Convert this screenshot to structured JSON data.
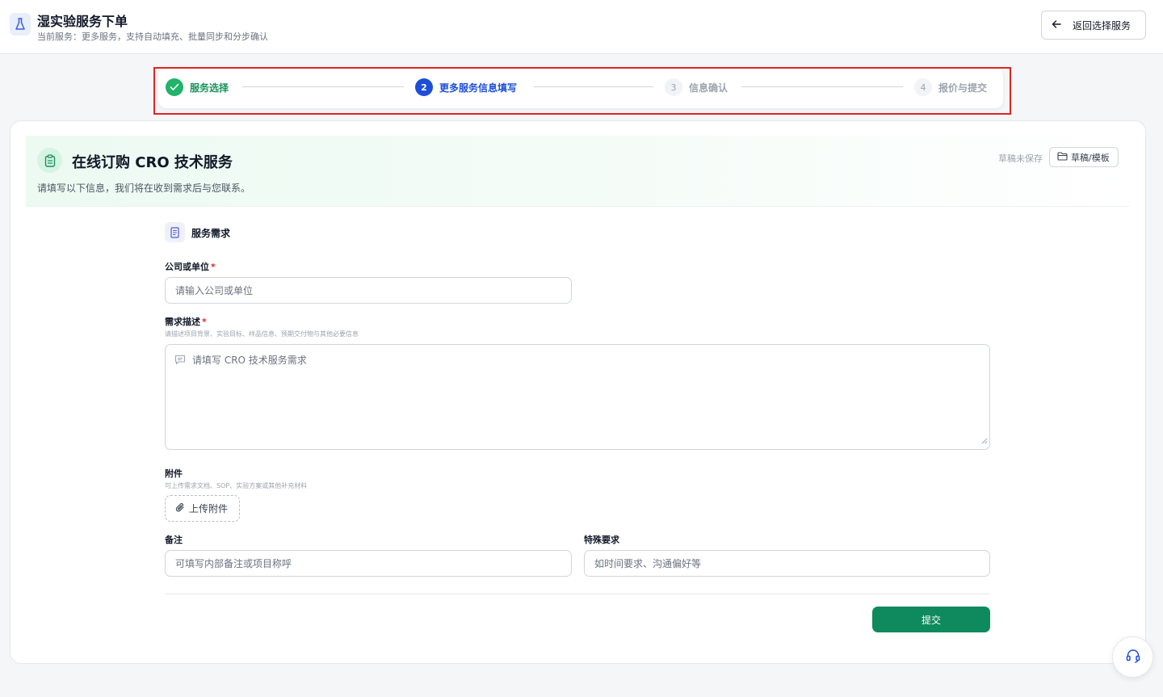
{
  "header": {
    "title": "湿实验服务下单",
    "subtitle": "当前服务：更多服务，支持自动填充、批量同步和分步确认",
    "back_label": "返回选择服务"
  },
  "stepper": {
    "steps": [
      {
        "num": "",
        "label": "服务选择",
        "state": "done"
      },
      {
        "num": "2",
        "label": "更多服务信息填写",
        "state": "active"
      },
      {
        "num": "3",
        "label": "信息确认",
        "state": "pending"
      },
      {
        "num": "4",
        "label": "报价与提交",
        "state": "pending"
      }
    ]
  },
  "hero": {
    "title": "在线订购 CRO 技术服务",
    "description": "请填写以下信息，我们将在收到需求后与您联系。",
    "draft_status": "草稿未保存",
    "draft_button": "草稿/模板"
  },
  "form": {
    "section_title": "服务需求",
    "company": {
      "label": "公司或单位",
      "required_mark": "*",
      "placeholder": "请输入公司或单位"
    },
    "description": {
      "label": "需求描述",
      "required_mark": "*",
      "hint": "请描述项目背景、实验目标、样品信息、预期交付物与其他必要信息",
      "placeholder": "请填写 CRO 技术服务需求"
    },
    "attachment": {
      "label": "附件",
      "hint": "可上传需求文档、SOP、实验方案或其他补充材料",
      "button": "上传附件"
    },
    "notes": {
      "label": "备注",
      "placeholder": "可填写内部备注或项目称呼"
    },
    "special": {
      "label": "特殊要求",
      "placeholder": "如时间要求、沟通偏好等"
    },
    "submit": "提交"
  },
  "colors": {
    "primary_green": "#0f8a5f",
    "active_blue": "#1d4ed8",
    "done_green": "#22b36b",
    "highlight_red": "#e02424"
  },
  "icons": {
    "app": "flask-icon",
    "back": "arrow-left-icon",
    "hero": "clipboard-icon",
    "draft": "folder-icon",
    "section": "document-icon",
    "textarea": "message-icon",
    "upload": "paperclip-icon",
    "support": "headset-icon"
  }
}
